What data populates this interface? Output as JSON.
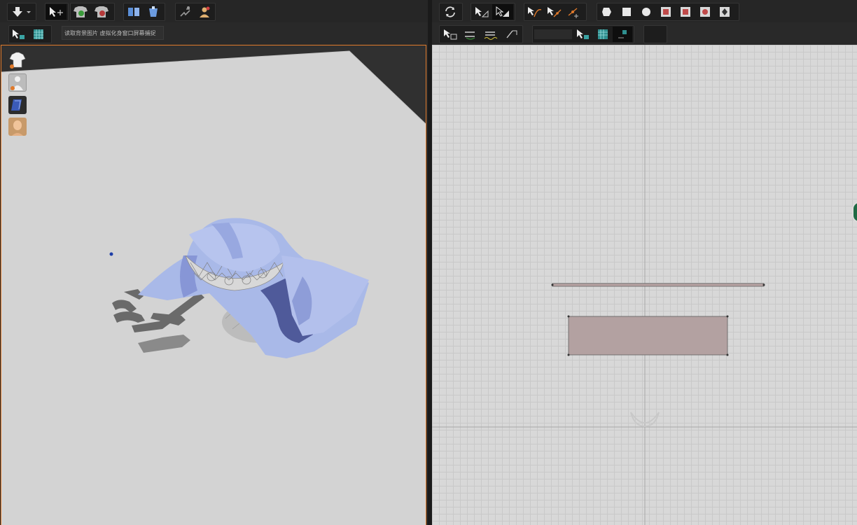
{
  "app": {
    "accent_color": "#e07a2b"
  },
  "left_panel": {
    "toolbar_top": {
      "icons": [
        "download-arrow-icon",
        "select-move-icon",
        "garment-add-icon",
        "garment-remove-icon",
        "fold-arrange-icon",
        "arrange-points-icon",
        "avatar-pose-icon",
        "avatar-add-icon"
      ]
    },
    "toolbar_second": {
      "icons": [
        "select-mesh-icon",
        "texture-grid-icon"
      ],
      "background_label": "读取背景图片 虚拟化身窗口屏幕捕捉"
    },
    "side_icons": [
      "garment-shirt-icon",
      "avatar-body-icon",
      "fabric-swatch-icon",
      "avatar-head-icon"
    ],
    "viewport": {
      "bg_color": "#d3d3d3",
      "cloth_color": "#a9b9e8"
    }
  },
  "right_panel": {
    "toolbar_top": {
      "icons": [
        "refresh-icon",
        "transform-pattern-icon",
        "edit-pattern-icon",
        "edit-curve-icon",
        "curve-point-icon",
        "add-point-icon",
        "polygon-icon",
        "rectangle-icon",
        "circle-icon",
        "internal-polygon-icon",
        "internal-rectangle-icon",
        "internal-circle-icon",
        "dart-icon"
      ]
    },
    "toolbar_second": {
      "icons": [
        "segment-sew-icon",
        "free-sew-icon",
        "sewing-line-icon",
        "check-sewing-icon",
        "select-mesh-icon",
        "texture-grid-icon",
        "uv-icon",
        "blank-button"
      ]
    },
    "viewport": {
      "bg_color": "#d8d8d8",
      "pattern_color": "#b3a1a1"
    }
  }
}
